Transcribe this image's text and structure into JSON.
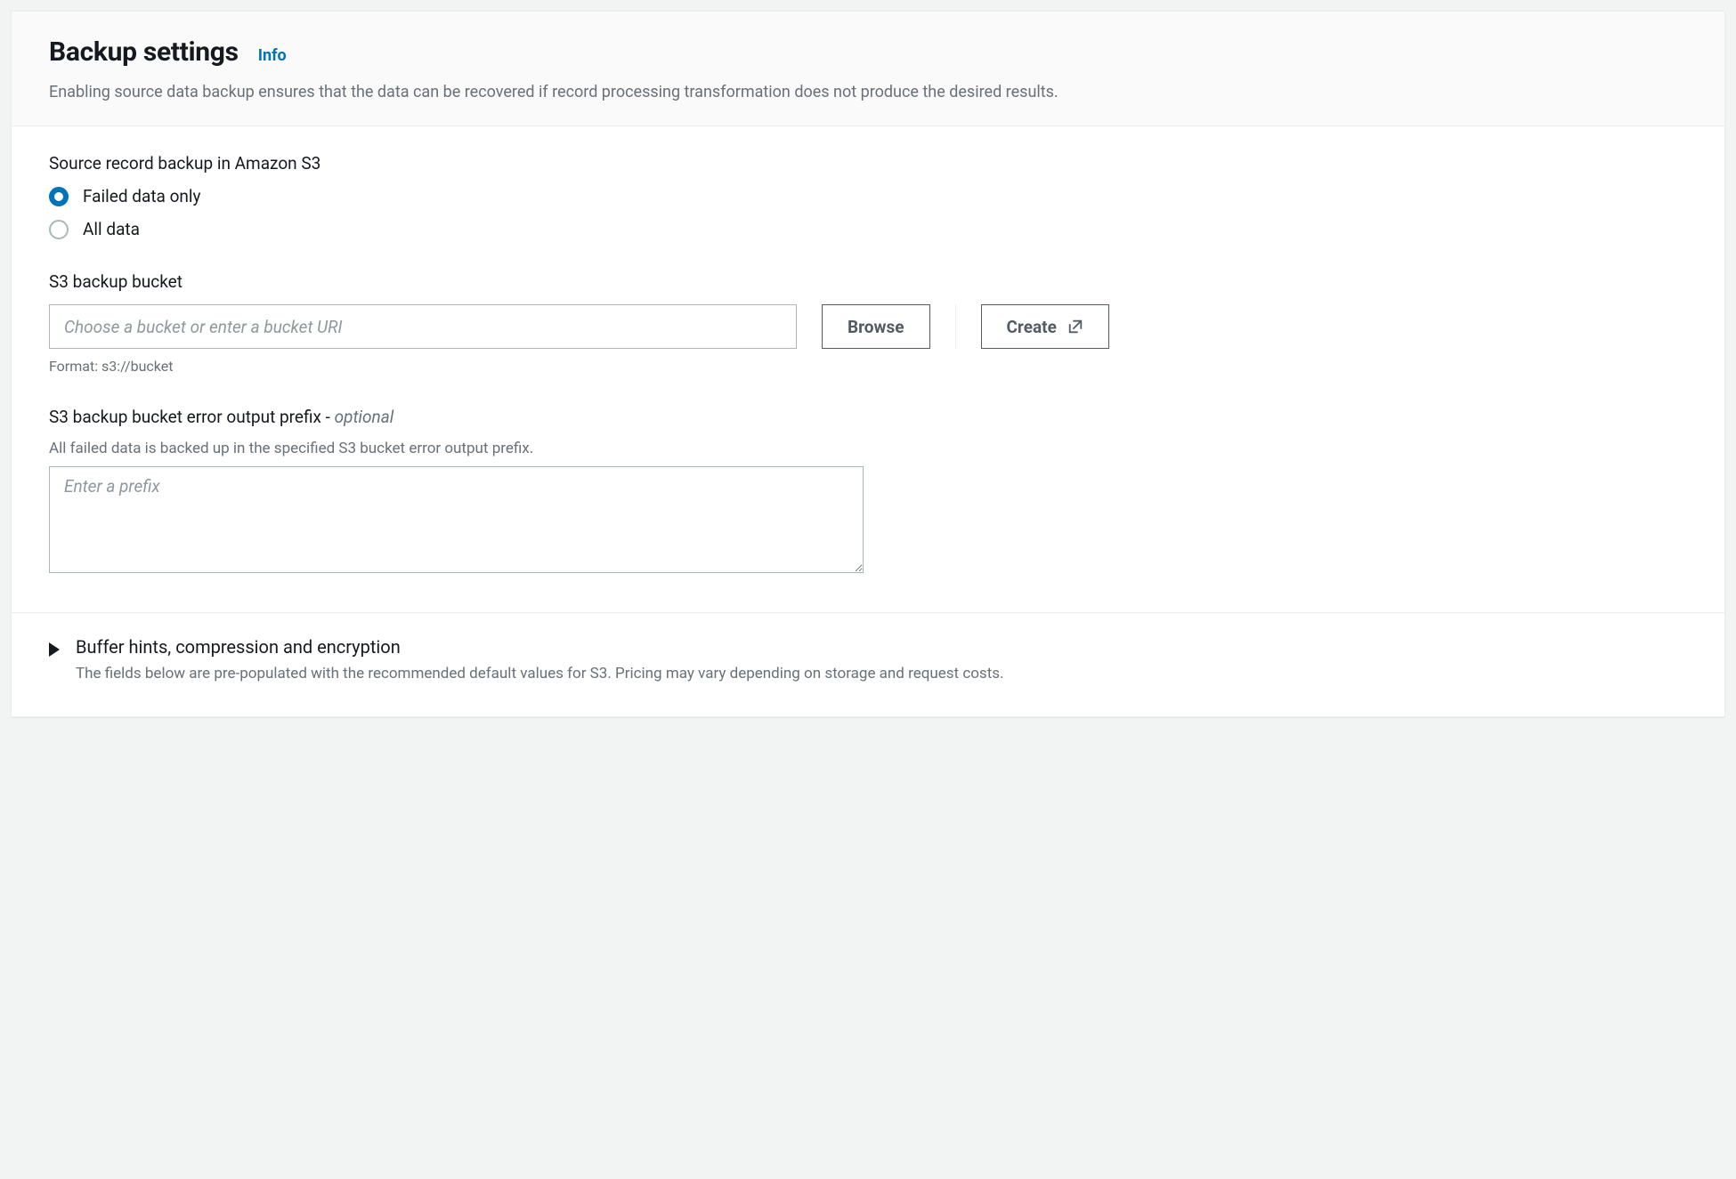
{
  "header": {
    "title": "Backup settings",
    "info_label": "Info",
    "subtitle": "Enabling source data backup ensures that the data can be recovered if record processing transformation does not produce the desired results."
  },
  "source_backup": {
    "label": "Source record backup in Amazon S3",
    "options": [
      {
        "label": "Failed data only",
        "selected": true
      },
      {
        "label": "All data",
        "selected": false
      }
    ]
  },
  "bucket": {
    "label": "S3 backup bucket",
    "placeholder": "Choose a bucket or enter a bucket URI",
    "value": "",
    "browse_label": "Browse",
    "create_label": "Create",
    "helper": "Format: s3://bucket"
  },
  "error_prefix": {
    "label_main": "S3 backup bucket error output prefix - ",
    "label_optional": "optional",
    "description": "All failed data is backed up in the specified S3 bucket error output prefix.",
    "placeholder": "Enter a prefix",
    "value": ""
  },
  "expand": {
    "title": "Buffer hints, compression and encryption",
    "description": "The fields below are pre-populated with the recommended default values for S3. Pricing may vary depending on storage and request costs."
  }
}
